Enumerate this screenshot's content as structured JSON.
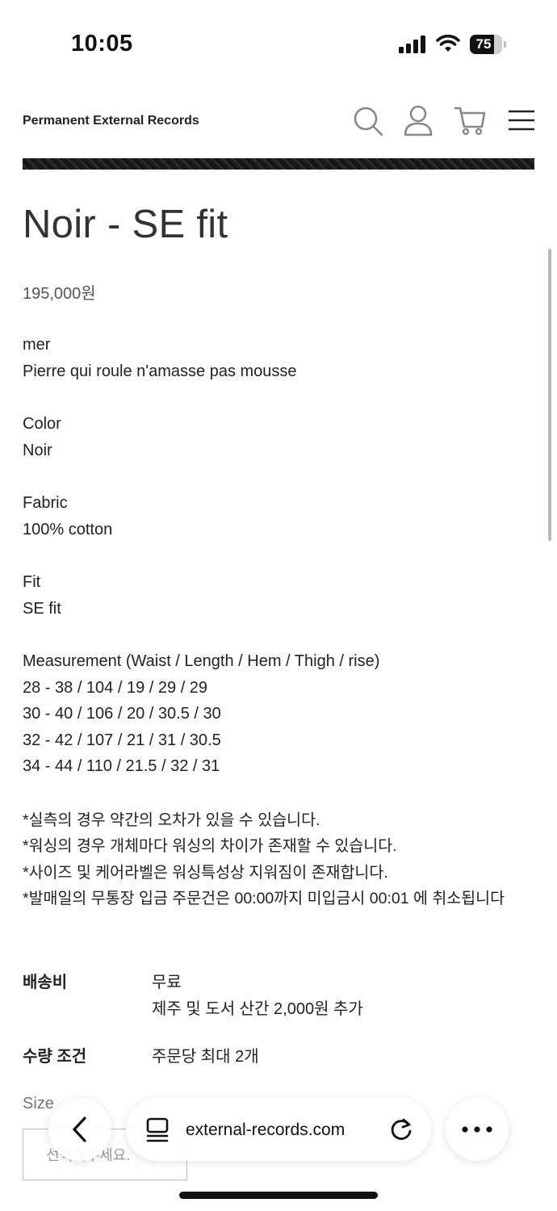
{
  "status_bar": {
    "time": "10:05",
    "battery": "75"
  },
  "header": {
    "brand": "Permanent External Records",
    "icons": [
      "search-icon",
      "user-icon",
      "cart-icon",
      "menu-icon"
    ]
  },
  "product": {
    "title": "Noir - SE fit",
    "price": "195,000원",
    "desc_lines": [
      "mer",
      "Pierre qui roule n'amasse pas mousse",
      "Color",
      "Noir",
      "Fabric",
      "100% cotton",
      "Fit",
      "SE fit",
      "Measurement (Waist / Length / Hem / Thigh / rise)",
      "28 - 38 / 104 / 19 / 29 / 29",
      "30 - 40 / 106 / 20 / 30.5 / 30",
      "32 - 42 / 107 / 21 / 31 / 30.5",
      "34 - 44 / 110 / 21.5 / 32 / 31"
    ],
    "notes": [
      "*실측의 경우 약간의 오차가 있을 수 있습니다.",
      "*워싱의 경우 개체마다 워싱의 차이가 존재할 수 있습니다.",
      "*사이즈 및 케어라벨은 워싱특성상 지워짐이 존재합니다.",
      "*발매일의 무통장 입금 주문건은 00:00까지 미입금시 00:01 에 취소됩니다"
    ]
  },
  "shipping": {
    "label": "배송비",
    "value": "무료",
    "extra": "제주 및 도서 산간 2,000원 추가"
  },
  "quantity": {
    "label": "수량 조건",
    "value": "주문당 최대 2개"
  },
  "size": {
    "label": "Size",
    "placeholder": "선택해주세요."
  },
  "browser": {
    "url": "external-records.com"
  },
  "colors": {
    "text": "#222222",
    "muted": "#777777",
    "accent": "#111111"
  }
}
